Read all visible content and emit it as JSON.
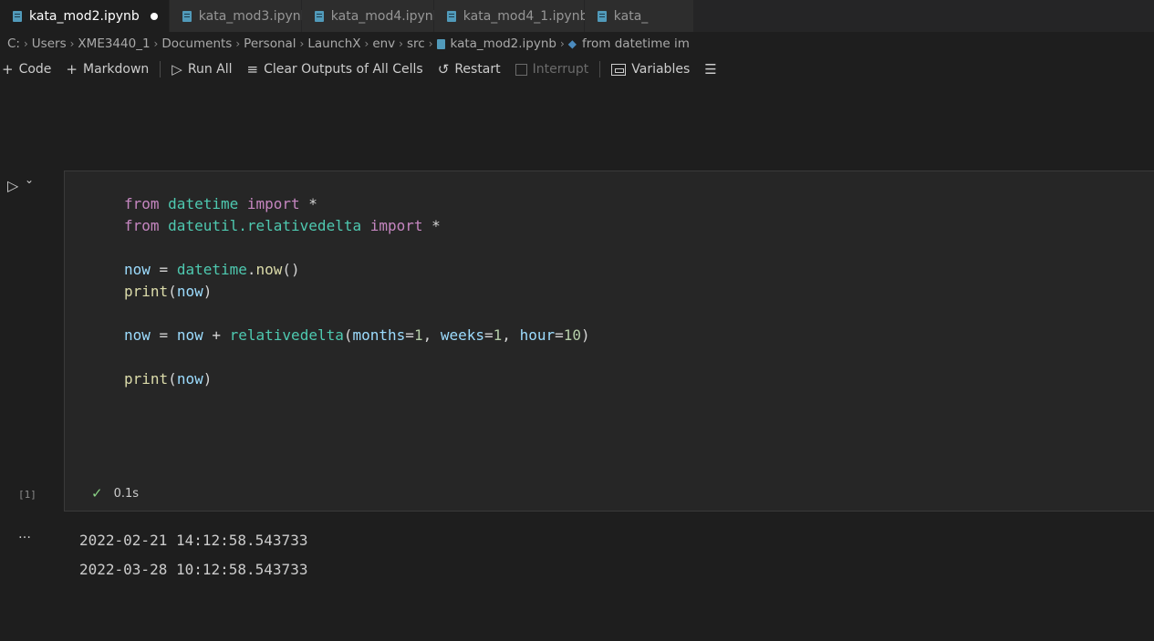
{
  "tabs": [
    {
      "label": "kata_mod2.ipynb",
      "active": true,
      "modified": true
    },
    {
      "label": "kata_mod3.ipynb",
      "active": false,
      "modified": false
    },
    {
      "label": "kata_mod4.ipynb",
      "active": false,
      "modified": false
    },
    {
      "label": "kata_mod4_1.ipynb",
      "active": false,
      "modified": true
    },
    {
      "label": "kata_",
      "active": false,
      "modified": false
    }
  ],
  "breadcrumb": {
    "items": [
      "C:",
      "Users",
      "XME3440_1",
      "Documents",
      "Personal",
      "LaunchX",
      "env",
      "src"
    ],
    "file": "kata_mod2.ipynb",
    "symbol": "from datetime im"
  },
  "toolbar": {
    "code_label": "Code",
    "markdown_label": "Markdown",
    "run_all_label": "Run All",
    "clear_outputs_label": "Clear Outputs of All Cells",
    "restart_label": "Restart",
    "interrupt_label": "Interrupt",
    "variables_label": "Variables"
  },
  "cell": {
    "execution_count": "[1]",
    "duration": "0.1s",
    "code_lines": [
      "from datetime import *",
      "from dateutil.relativedelta import *",
      "",
      "now = datetime.now()",
      "print(now)",
      "",
      "now = now + relativedelta(months=1, weeks=1, hour=10)",
      "",
      "print(now)"
    ]
  },
  "output": {
    "lines": [
      "2022-02-21 14:12:58.543733",
      "2022-03-28 10:12:58.543733"
    ]
  },
  "colors": {
    "background": "#1e1e1e",
    "cell_background": "#262626",
    "keyword": "#c586c0",
    "module": "#4ec9b0",
    "variable": "#9cdcfe",
    "function": "#dcdcaa",
    "number": "#b5cea8",
    "success": "#89d185"
  }
}
